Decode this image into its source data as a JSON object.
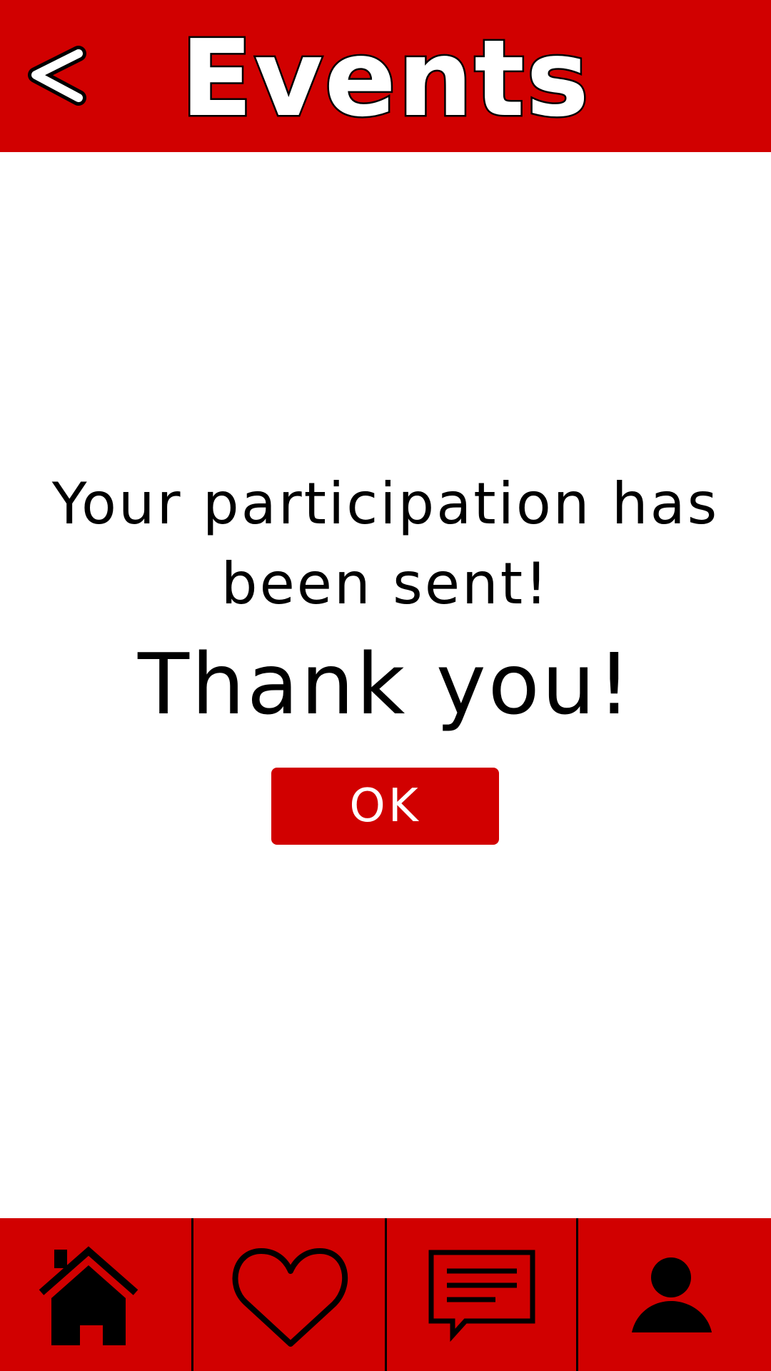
{
  "header": {
    "title": "Events",
    "back_icon": "chevron-left-icon"
  },
  "main": {
    "message": "Your participation has been sent!",
    "thanks": "Thank you!",
    "ok_label": "OK"
  },
  "bottom_nav": {
    "items": [
      {
        "name": "home",
        "icon": "home-icon"
      },
      {
        "name": "favorites",
        "icon": "heart-icon"
      },
      {
        "name": "messages",
        "icon": "chat-icon"
      },
      {
        "name": "profile",
        "icon": "user-icon"
      }
    ]
  },
  "colors": {
    "accent": "#d10000",
    "background": "#ffffff",
    "text": "#000000"
  }
}
